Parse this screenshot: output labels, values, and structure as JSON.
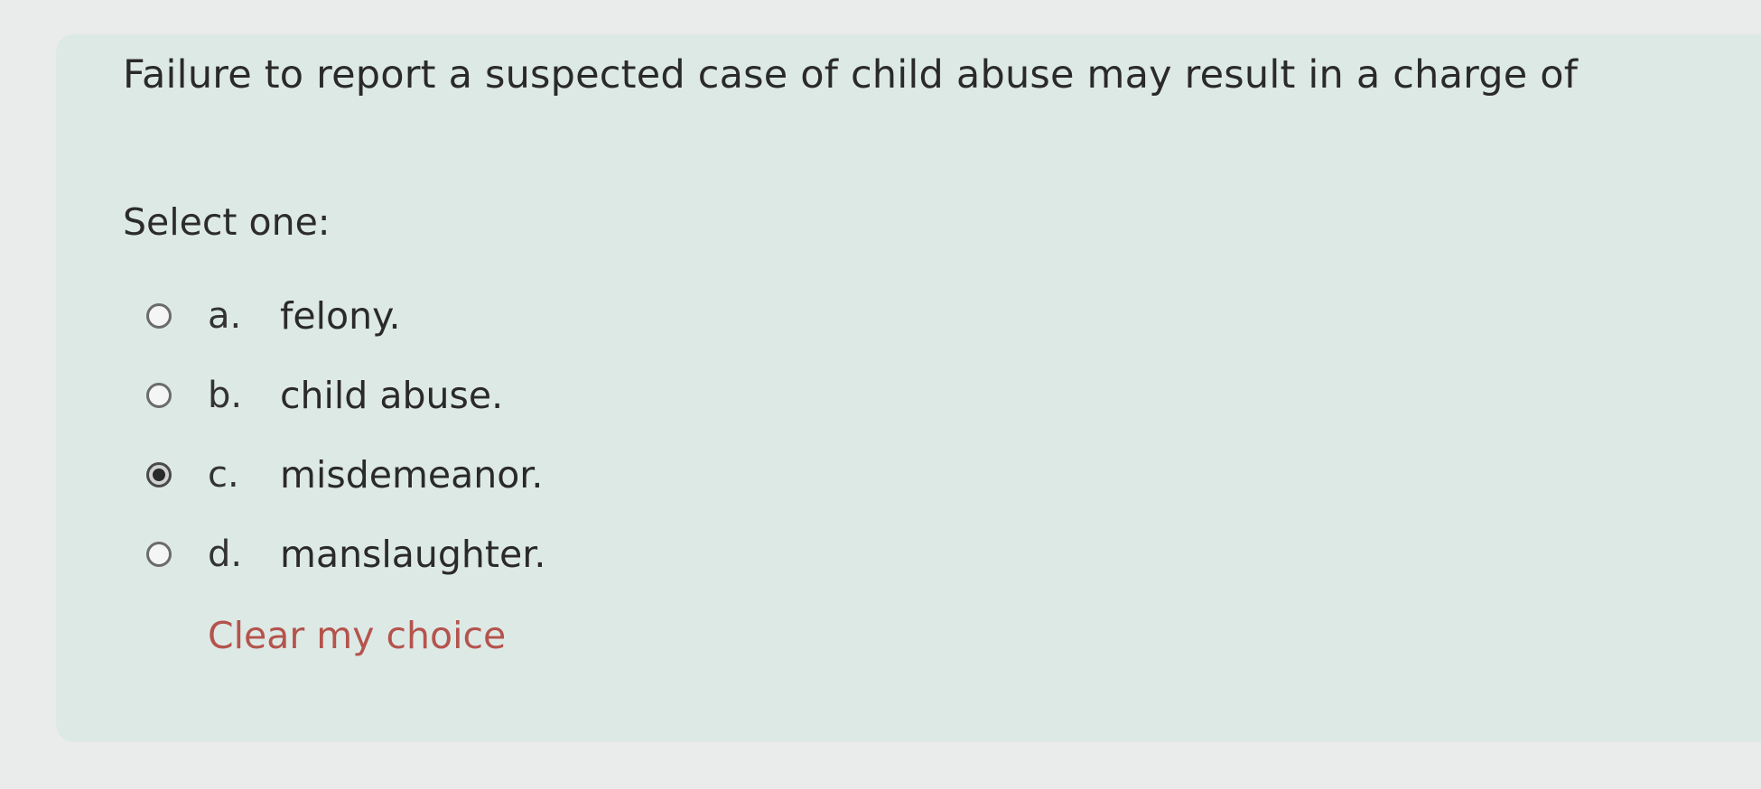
{
  "question": {
    "text": "Failure to report a suspected case of child abuse may result in a charge of",
    "prompt": "Select one:"
  },
  "options": [
    {
      "letter": "a.",
      "text": "felony.",
      "selected": false
    },
    {
      "letter": "b.",
      "text": "child abuse.",
      "selected": false
    },
    {
      "letter": "c.",
      "text": "misdemeanor.",
      "selected": true
    },
    {
      "letter": "d.",
      "text": "manslaughter.",
      "selected": false
    }
  ],
  "clear_choice_label": "Clear my choice",
  "colors": {
    "card_background": "#dde9e5",
    "link": "#b5534d",
    "text": "#2a2a2a"
  }
}
